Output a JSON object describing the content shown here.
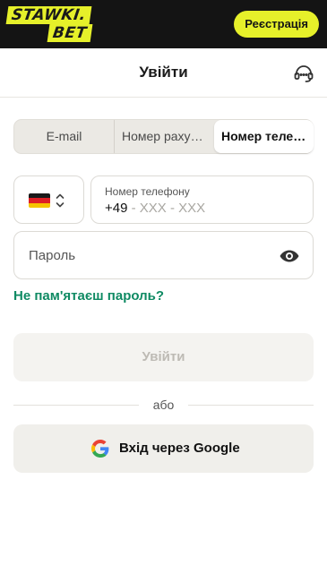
{
  "brand": {
    "logo_line1": "STAWKI.",
    "logo_line2": "BET",
    "accent": "#e6f02a",
    "dark": "#141414"
  },
  "topbar": {
    "register_label": "Реєстрація"
  },
  "header": {
    "title": "Увійти",
    "support_icon": "headset-icon"
  },
  "tabs": [
    {
      "label": "E-mail",
      "active": false
    },
    {
      "label": "Номер рахунку",
      "active": false
    },
    {
      "label": "Номер телефону",
      "active": true
    }
  ],
  "country": {
    "flag": "germany-flag",
    "selector_icon": "chevron-updown-icon"
  },
  "phone": {
    "label": "Номер телефону",
    "code": "+49",
    "mask": " - XXX - XXX"
  },
  "password": {
    "placeholder": "Пароль",
    "toggle_icon": "eye-icon"
  },
  "forgot_link": "Не пам'ятаєш пароль?",
  "login_button": "Увійти",
  "divider_text": "або",
  "google_button": {
    "label": "Вхід через Google",
    "icon": "google-icon"
  },
  "colors": {
    "link_green": "#0f8a63",
    "disabled_text": "#bdbab4"
  }
}
